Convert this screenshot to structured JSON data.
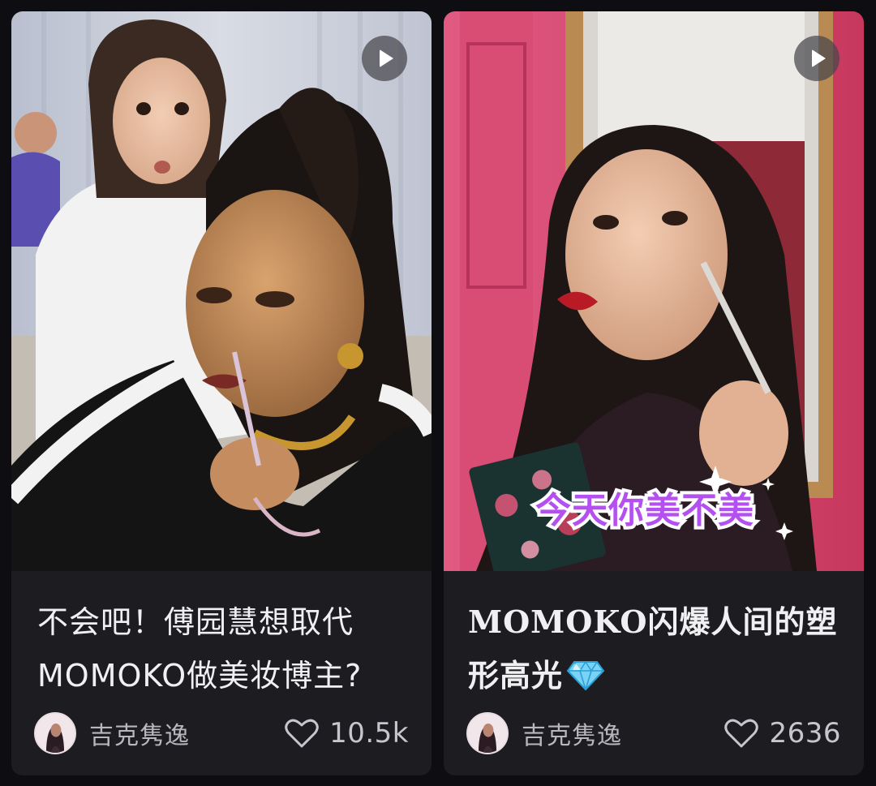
{
  "feed": {
    "cards": [
      {
        "title_line1": "不会吧！傅园慧想取代",
        "title_line2": "MOMOKO做美妆博主?",
        "author": "吉克隽逸",
        "likes": "10.5k",
        "play_icon": "play-icon",
        "like_icon": "heart-outline-icon"
      },
      {
        "title_line1": "MOMOKO闪爆人间的塑",
        "title_line2": "形高光",
        "title_emoji": "gem-icon",
        "author": "吉克隽逸",
        "likes": "2636",
        "thumbnail_caption": "今天你美不美",
        "play_icon": "play-icon",
        "like_icon": "heart-outline-icon"
      }
    ]
  },
  "colors": {
    "background": "#0e0e12",
    "card": "#1c1c21",
    "title_text": "#f0f0f2",
    "meta_text": "#b7b7bd",
    "caption_fill": "#b44ff0",
    "left_thumb_wall": "#c9cdd8",
    "right_thumb_wall": "#d6466f"
  }
}
